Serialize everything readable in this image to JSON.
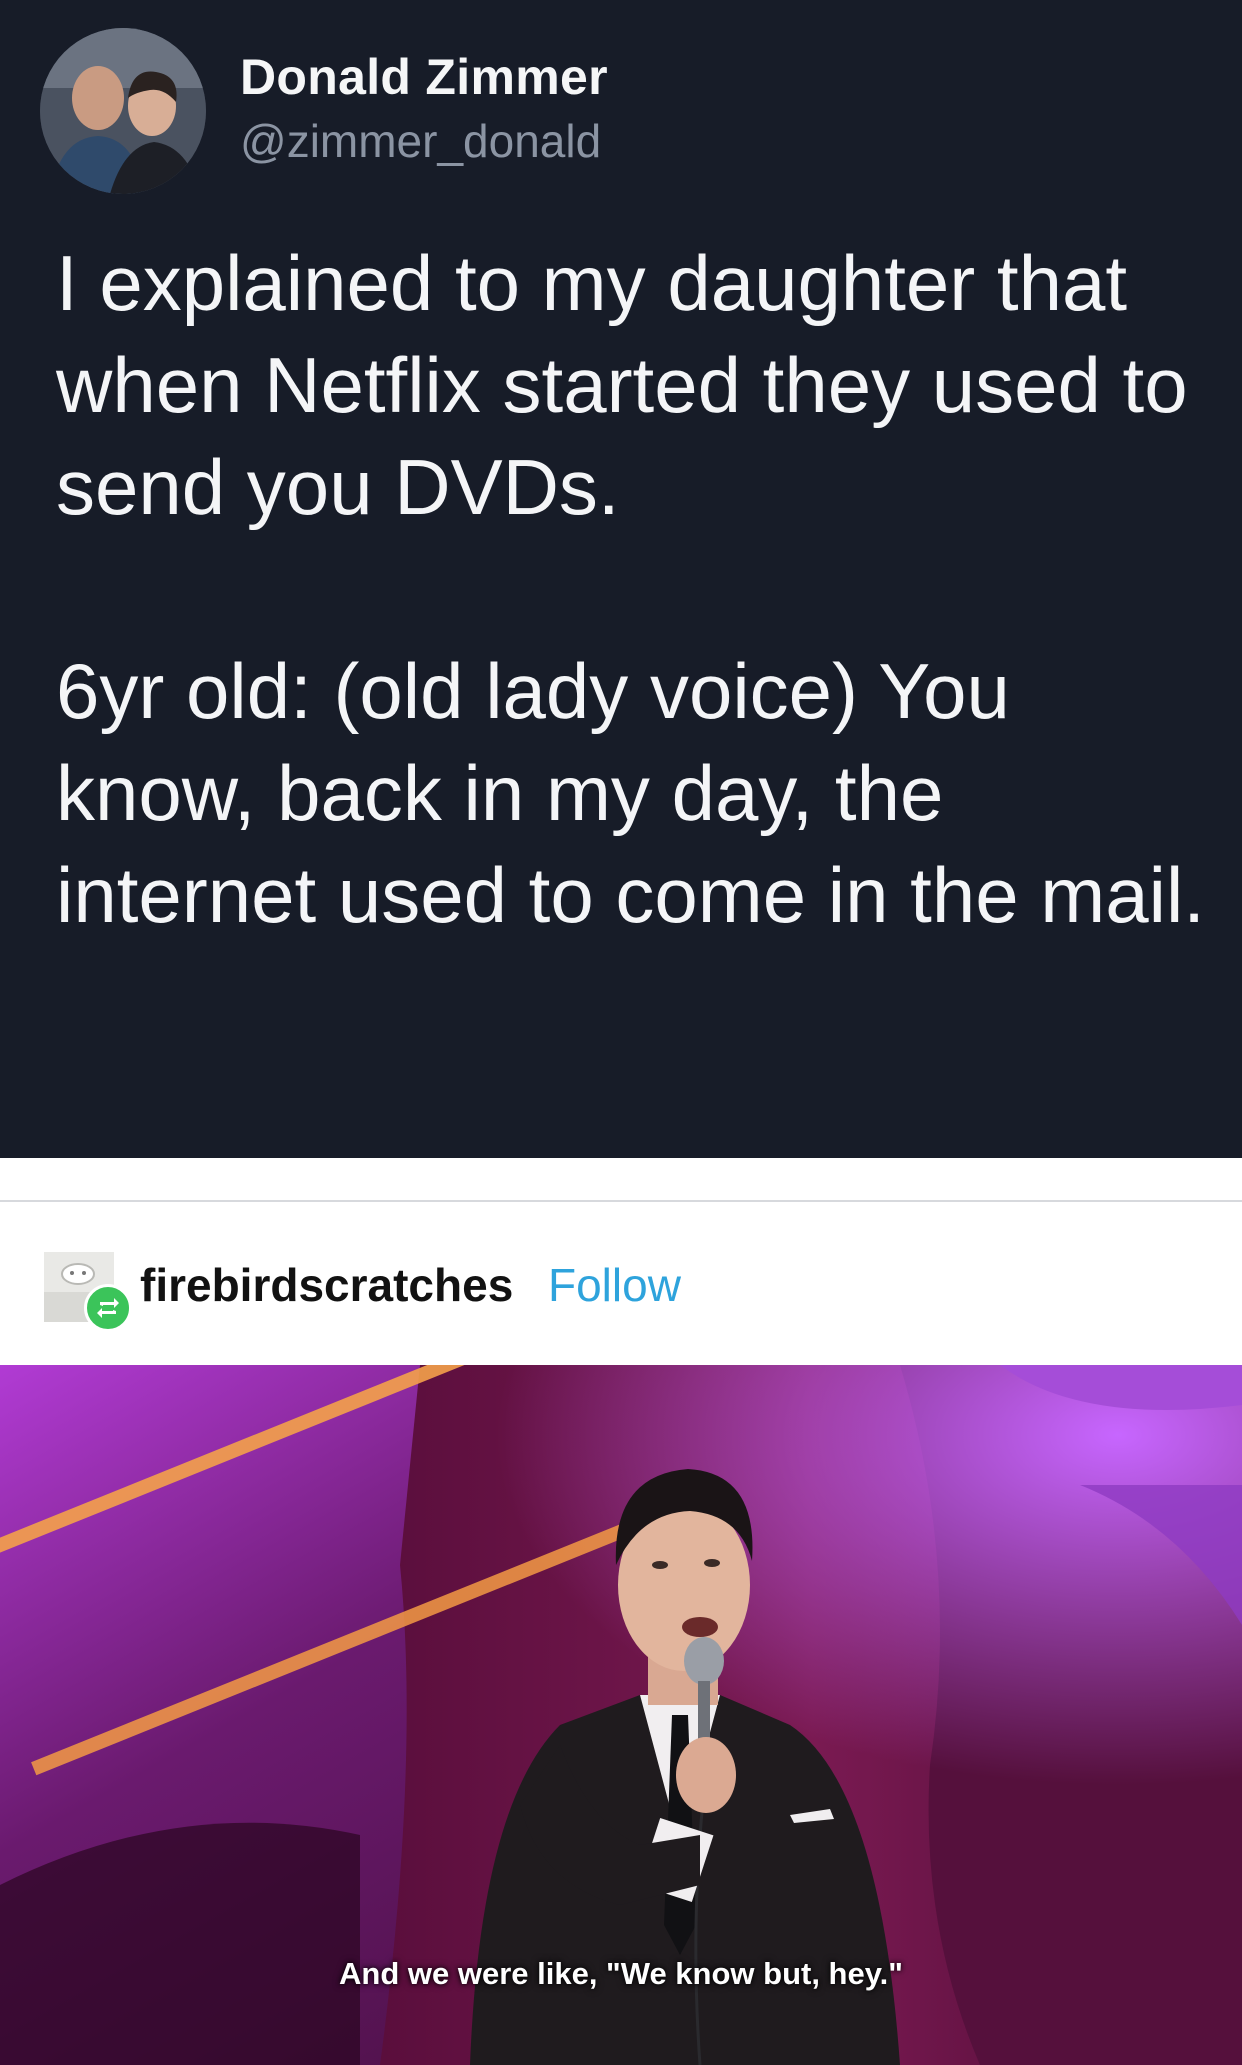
{
  "tweet": {
    "author_name": "Donald Zimmer",
    "author_handle": "@zimmer_donald",
    "avatar_icon": "profile-photo",
    "paragraphs": [
      "I explained to my daughter that when Netflix started they used to send you DVDs.",
      "6yr old: (old lady voice) You know, back in my day, the internet used to come in the mail."
    ],
    "colors": {
      "background": "#171c28",
      "text": "#f4f5f7",
      "handle": "#8b94a3"
    }
  },
  "reblog": {
    "username": "firebirdscratches",
    "follow_label": "Follow",
    "badge_icon": "reblog-icon",
    "colors": {
      "follow": "#2ea3dc",
      "badge": "#3bc45a"
    }
  },
  "photo": {
    "subtitle": "And we were like, \"We know but, hey.\"",
    "colors": {
      "stage_purple": "#7a1fa8",
      "curtain": "#5a0f3e",
      "suit": "#1e1a1c"
    }
  }
}
